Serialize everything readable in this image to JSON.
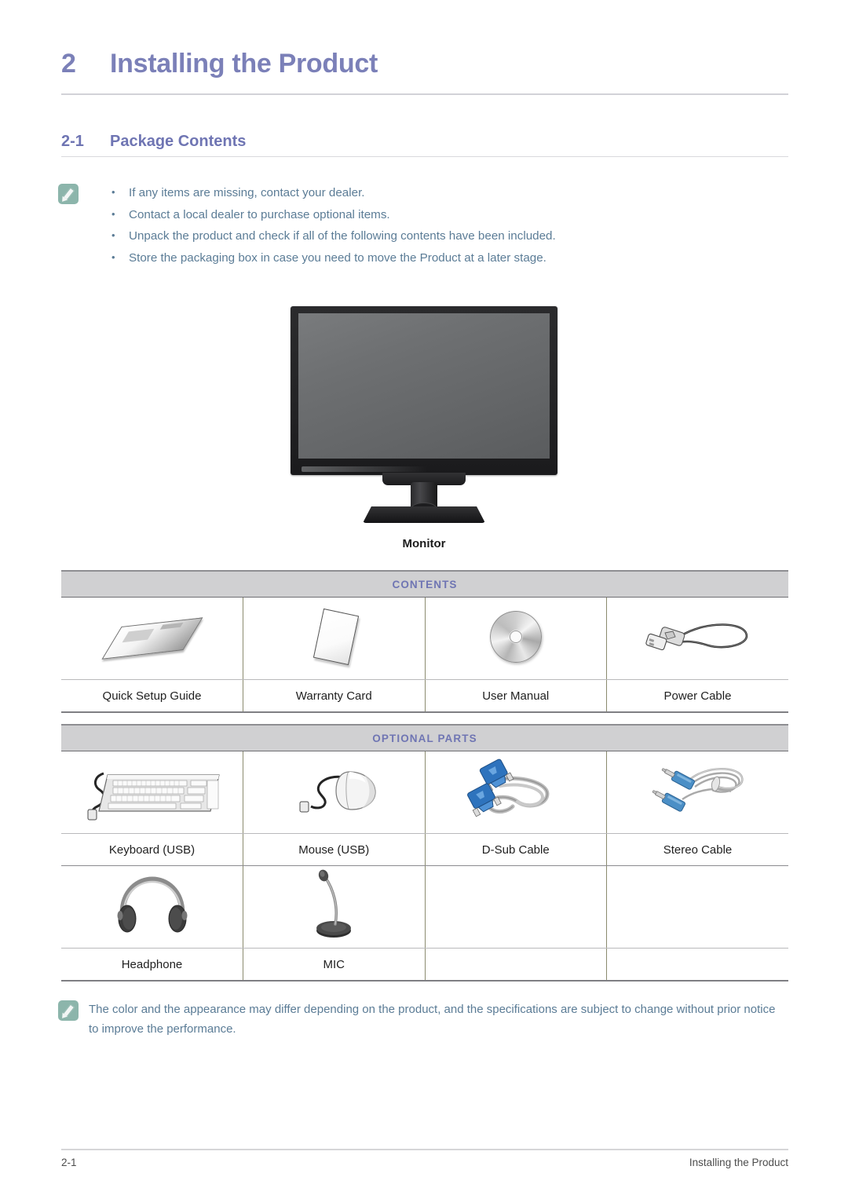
{
  "chapter": {
    "number": "2",
    "title": "Installing the Product"
  },
  "section": {
    "number": "2-1",
    "title": "Package Contents"
  },
  "top_note": {
    "icon": "note-pencil-icon",
    "bullets": [
      "If any items are missing, contact your dealer.",
      "Contact a local dealer to purchase optional items.",
      "Unpack the product and check if all of the following contents have been included.",
      "Store the packaging box in case you need to move the Product at a later stage."
    ]
  },
  "monitor_figure": {
    "caption": "Monitor",
    "icon": "monitor-icon"
  },
  "tables": [
    {
      "id": "contents",
      "header": "CONTENTS",
      "rows": [
        [
          {
            "label": "Quick Setup Guide",
            "icon": "booklet-icon"
          },
          {
            "label": "Warranty Card",
            "icon": "card-icon"
          },
          {
            "label": "User Manual",
            "icon": "cd-disc-icon"
          },
          {
            "label": "Power Cable",
            "icon": "power-cable-icon"
          }
        ]
      ]
    },
    {
      "id": "optional",
      "header": "OPTIONAL PARTS",
      "rows": [
        [
          {
            "label": "Keyboard (USB)",
            "icon": "keyboard-icon"
          },
          {
            "label": "Mouse (USB)",
            "icon": "mouse-icon"
          },
          {
            "label": "D-Sub Cable",
            "icon": "dsub-cable-icon"
          },
          {
            "label": "Stereo Cable",
            "icon": "stereo-cable-icon"
          }
        ],
        [
          {
            "label": "Headphone",
            "icon": "headphone-icon"
          },
          {
            "label": "MIC",
            "icon": "microphone-icon"
          },
          {
            "label": "",
            "icon": ""
          },
          {
            "label": "",
            "icon": ""
          }
        ]
      ]
    }
  ],
  "bottom_note": {
    "icon": "note-pencil-icon",
    "text": "The color and the appearance may differ depending on the product, and the specifications are subject to change without prior notice to improve the performance."
  },
  "footer": {
    "page_number": "2-1",
    "chapter_label": "Installing the Product"
  },
  "colors": {
    "heading_purple": "#7b80b8",
    "section_purple": "#6f75b3",
    "note_text_blue": "#5b7c96",
    "note_icon_green": "#8cb5ab",
    "table_header_bg": "#d0d0d2"
  }
}
